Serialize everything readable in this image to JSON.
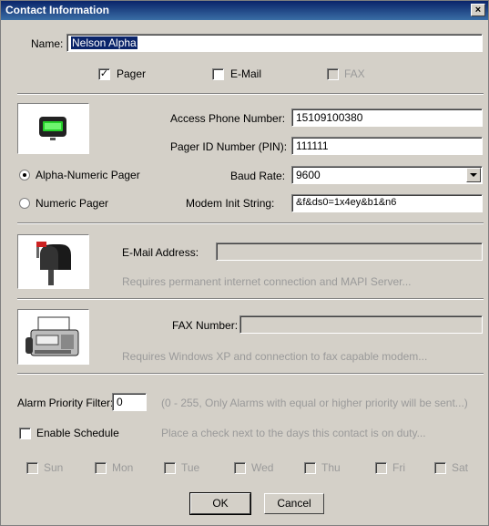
{
  "window": {
    "title": "Contact Information",
    "close_label": "×"
  },
  "name": {
    "label": "Name:",
    "value": "Nelson Alpha"
  },
  "methods": {
    "pager": {
      "label": "Pager",
      "checked": true
    },
    "email": {
      "label": "E-Mail",
      "checked": false
    },
    "fax": {
      "label": "FAX",
      "checked": false,
      "disabled": true
    }
  },
  "pager_section": {
    "access_phone_label": "Access Phone Number:",
    "access_phone_value": "15109100380",
    "pager_id_label": "Pager ID Number (PIN):",
    "pager_id_value": "111111",
    "baud_label": "Baud Rate:",
    "baud_value": "9600",
    "modem_label": "Modem Init String:",
    "modem_value": "&f&ds0=1x4ey&b1&n6",
    "type_alpha_label": "Alpha-Numeric Pager",
    "type_numeric_label": "Numeric Pager",
    "selected_type": "alpha"
  },
  "email_section": {
    "label": "E-Mail Address:",
    "value": "",
    "note": "Requires permanent internet connection and MAPI Server..."
  },
  "fax_section": {
    "label": "FAX Number:",
    "value": "",
    "note": "Requires Windows XP and connection to fax capable modem..."
  },
  "alarm": {
    "label": "Alarm Priority Filter:",
    "value": "0",
    "note": "(0 - 255, Only Alarms with equal or higher priority will be sent...)"
  },
  "schedule": {
    "label": "Enable Schedule",
    "note": "Place a check next to the days this contact is on duty...",
    "days": [
      "Sun",
      "Mon",
      "Tue",
      "Wed",
      "Thu",
      "Fri",
      "Sat"
    ]
  },
  "buttons": {
    "ok": "OK",
    "cancel": "Cancel"
  },
  "colors": {
    "titlebar": "#0a246a",
    "face": "#d4d0c8",
    "disabled_text": "#9a9a9a"
  }
}
